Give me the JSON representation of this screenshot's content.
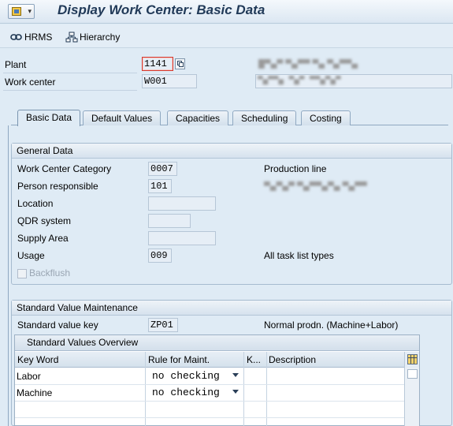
{
  "title": {
    "text": "Display Work Center: Basic Data",
    "menu_icon": "sap-menu-icon"
  },
  "toolbar": {
    "hrms_label": "HRMS",
    "hierarchy_label": "Hierarchy"
  },
  "header": {
    "plant_label": "Plant",
    "plant_value": "1141",
    "work_center_label": "Work center",
    "work_center_value": "W001"
  },
  "tabs": [
    {
      "label": "Basic Data",
      "active": true
    },
    {
      "label": "Default Values",
      "active": false
    },
    {
      "label": "Capacities",
      "active": false
    },
    {
      "label": "Scheduling",
      "active": false
    },
    {
      "label": "Costing",
      "active": false
    }
  ],
  "general_data": {
    "title": "General Data",
    "category_label": "Work Center Category",
    "category_value": "0007",
    "category_desc": "Production line",
    "person_label": "Person responsible",
    "person_value": "101",
    "location_label": "Location",
    "location_value": "",
    "qdr_label": "QDR system",
    "qdr_value": "",
    "supply_label": "Supply Area",
    "supply_value": "",
    "usage_label": "Usage",
    "usage_value": "009",
    "usage_desc": "All task list types",
    "backflush_label": "Backflush"
  },
  "std_values": {
    "title": "Standard Value Maintenance",
    "key_label": "Standard value key",
    "key_value": "ZP01",
    "key_desc": "Normal prodn. (Machine+Labor)",
    "overview_title": "Standard Values Overview",
    "columns": [
      "Key Word",
      "Rule for Maint.",
      "K...",
      "Description"
    ],
    "rows": [
      {
        "keyword": "Labor",
        "rule": "no checking",
        "k": "",
        "description": ""
      },
      {
        "keyword": "Machine",
        "rule": "no checking",
        "k": "",
        "description": ""
      }
    ]
  },
  "colors": {
    "background": "#dfebf5",
    "title_text": "#213a58",
    "focus_border": "#d43a2f"
  }
}
